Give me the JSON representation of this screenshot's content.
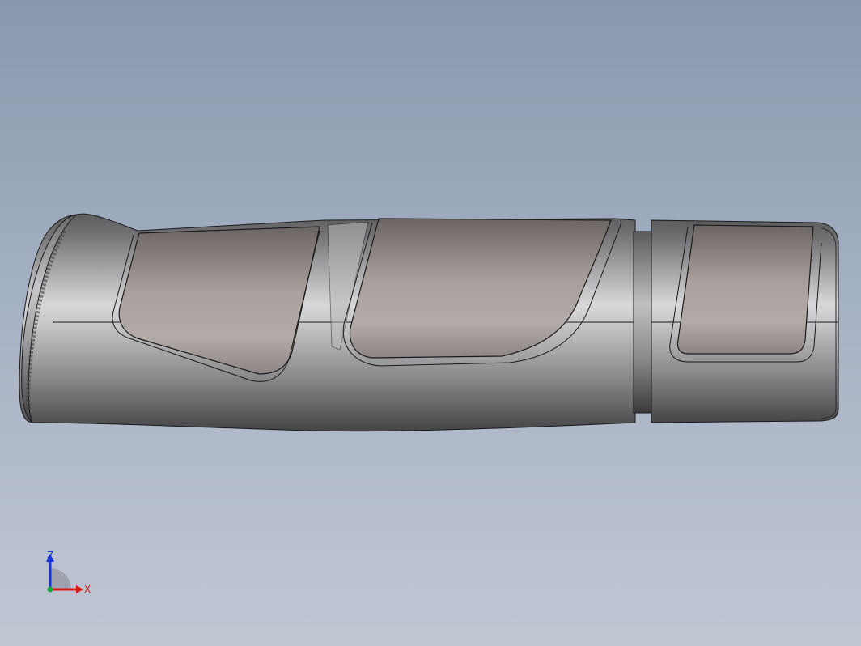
{
  "viewport": {
    "background_top": "#8898ad",
    "background_bottom": "#c1c7d3"
  },
  "model": {
    "body_color": "#8a8a8c",
    "pad_color": "#9a8f8c",
    "edge_color": "#1a1a1a"
  },
  "triad": {
    "z_label": "Z",
    "x_label": "X",
    "z_color": "#1533d6",
    "x_color": "#d61a1a",
    "y_color": "#1aa63a"
  }
}
